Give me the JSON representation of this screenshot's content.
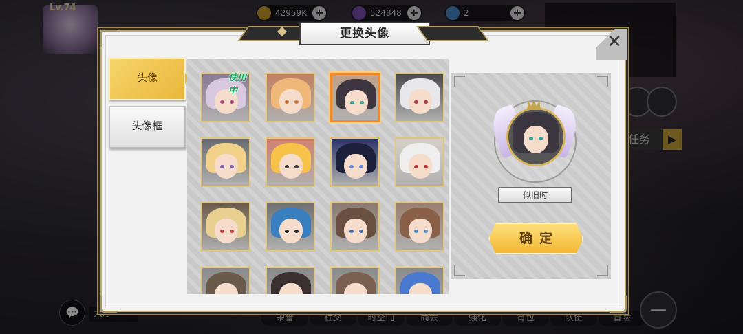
{
  "hud": {
    "level": "Lv.74",
    "gold": "42959K",
    "gems": "524848",
    "tickets": "2",
    "colors": {
      "gold": "#c79b2a",
      "gems": "#7a4db0",
      "tickets": "#4a88c8"
    }
  },
  "side_buttons": {
    "task_label": "任务"
  },
  "bottom_nav": [
    "荣誉",
    "社交",
    "时空门",
    "商会",
    "强化",
    "背包",
    "队伍",
    "冒险"
  ],
  "chat": {
    "label": "大厅"
  },
  "modal": {
    "title": "更换头像",
    "close_icon": "close-icon",
    "tabs": [
      {
        "label": "头像",
        "active": true
      },
      {
        "label": "头像框",
        "active": false
      }
    ],
    "in_use_label": "使用中",
    "preview_name": "似旧时",
    "confirm_label": "确定"
  },
  "avatars": [
    {
      "hair": "#d8c8e0",
      "eye": "#b04a7a",
      "bg": "#8a7a95"
    },
    {
      "hair": "#f0b878",
      "eye": "#c87030",
      "bg": "#c08060"
    },
    {
      "hair": "#3d3640",
      "eye": "#3aa09a",
      "bg": "#c0a088"
    },
    {
      "hair": "#e8e8ea",
      "eye": "#b03040",
      "bg": "#4a4a4e"
    },
    {
      "hair": "#f2d28a",
      "eye": "#7a5ab0",
      "bg": "#6a6a74"
    },
    {
      "hair": "#f7c24a",
      "eye": "#3a3a3a",
      "bg": "#d08070"
    },
    {
      "hair": "#1c1f3a",
      "eye": "#5a8ad8",
      "bg": "#2c3468"
    },
    {
      "hair": "#eeeeee",
      "eye": "#c03030",
      "bg": "#d8d0c8"
    },
    {
      "hair": "#e8d090",
      "eye": "#c04040",
      "bg": "#6a5a4a"
    },
    {
      "hair": "#3a80c0",
      "eye": "#2a2a2a",
      "bg": "#707070"
    },
    {
      "hair": "#6a5040",
      "eye": "#3a70b0",
      "bg": "#8a7a70"
    },
    {
      "hair": "#8a6048",
      "eye": "#4a8ac8",
      "bg": "#9a8070"
    },
    {
      "hair": "#6a5a4a",
      "eye": "#333",
      "bg": "#8a8a8a"
    },
    {
      "hair": "#3a3030",
      "eye": "#333",
      "bg": "#8a8a8a"
    },
    {
      "hair": "#7a6050",
      "eye": "#333",
      "bg": "#8a8a8a"
    },
    {
      "hair": "#4a7ad0",
      "eye": "#333",
      "bg": "#8a8a8a"
    }
  ]
}
